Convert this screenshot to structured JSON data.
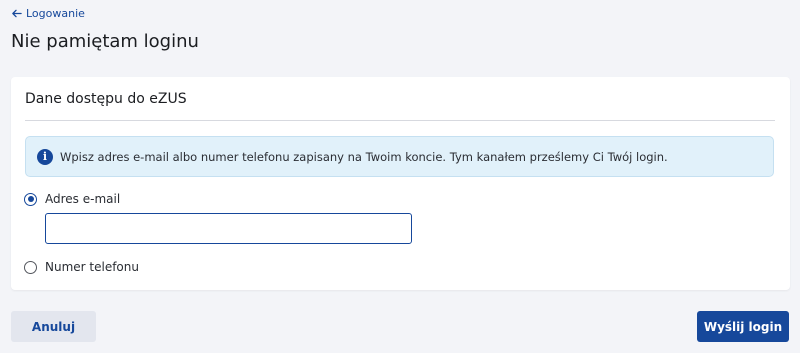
{
  "nav": {
    "back_label": "Logowanie",
    "back_icon": "arrow-left-icon"
  },
  "page": {
    "title": "Nie pamiętam loginu"
  },
  "card": {
    "title": "Dane dostępu do eZUS",
    "info": {
      "icon": "info-icon",
      "icon_glyph": "i",
      "text": "Wpisz adres e-mail albo numer telefonu zapisany na Twoim koncie. Tym kanałem prześlemy Ci Twój login."
    },
    "options": [
      {
        "label": "Adres e-mail",
        "selected": true
      },
      {
        "label": "Numer telefonu",
        "selected": false
      }
    ],
    "email_input": {
      "value": "",
      "placeholder": ""
    }
  },
  "actions": {
    "cancel_label": "Anuluj",
    "submit_label": "Wyślij login"
  },
  "colors": {
    "accent": "#16489b",
    "info_bg": "#e1f1fa",
    "page_bg": "#f3f4f8"
  }
}
